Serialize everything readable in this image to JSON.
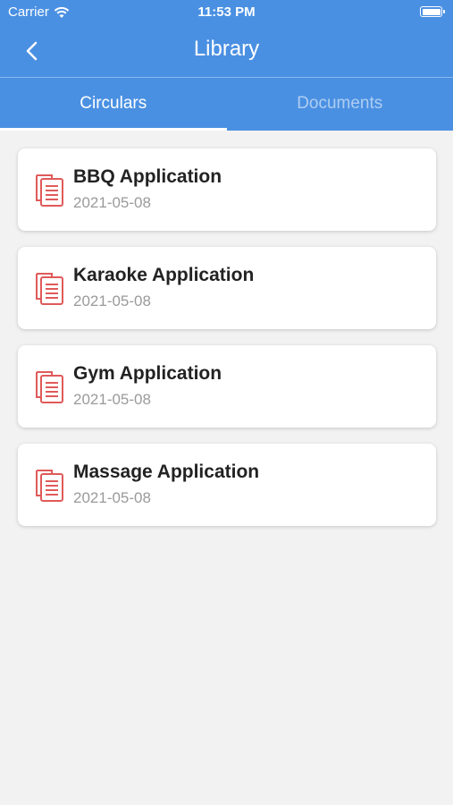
{
  "status_bar": {
    "carrier": "Carrier",
    "time": "11:53 PM"
  },
  "navbar": {
    "title": "Library"
  },
  "tabs": [
    {
      "label": "Circulars",
      "active": true
    },
    {
      "label": "Documents",
      "active": false
    }
  ],
  "items": [
    {
      "title": "BBQ Application",
      "date": "2021-05-08"
    },
    {
      "title": "Karaoke Application",
      "date": "2021-05-08"
    },
    {
      "title": "Gym Application",
      "date": "2021-05-08"
    },
    {
      "title": "Massage Application",
      "date": "2021-05-08"
    }
  ],
  "colors": {
    "header": "#4a90e2",
    "icon": "#e05a5a",
    "background": "#f2f2f2"
  }
}
